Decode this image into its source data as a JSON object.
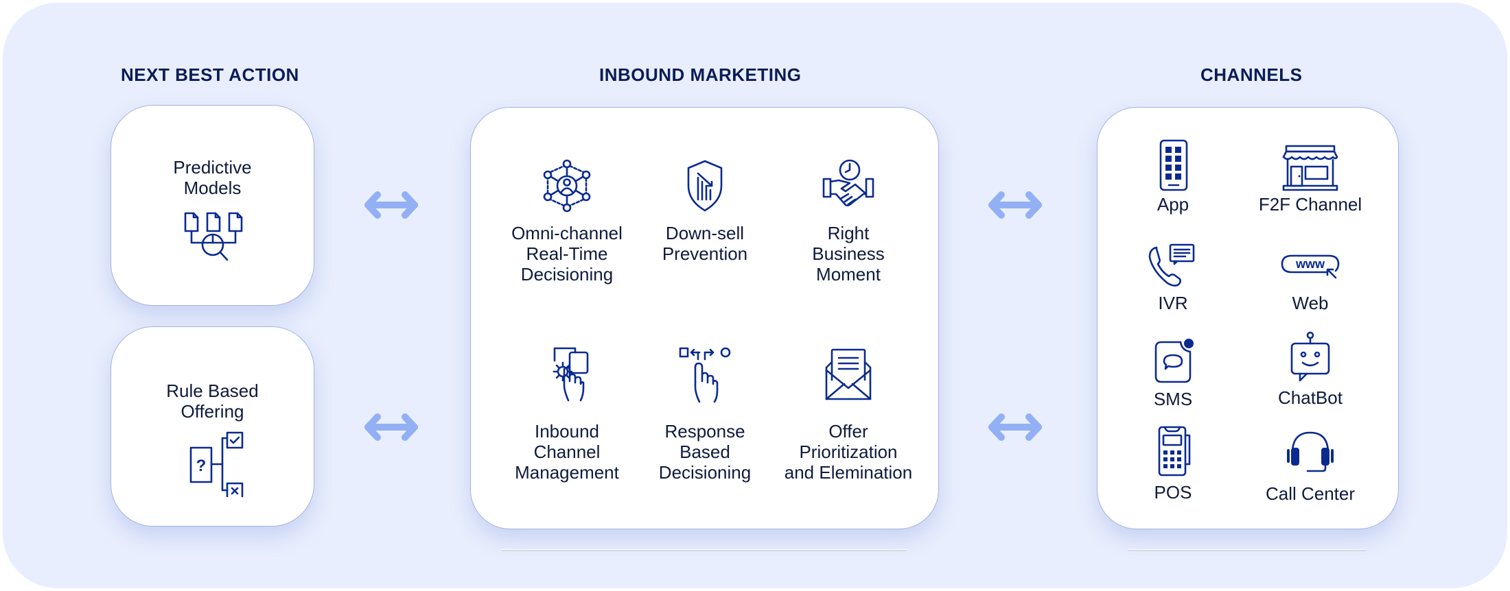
{
  "sections": {
    "next_best_action": {
      "title": "NEXT BEST ACTION",
      "items": [
        {
          "label": "Predictive\nModels",
          "icon": "predictive-models-icon"
        },
        {
          "label": "Rule Based\nOffering",
          "icon": "rule-decision-tree-icon"
        }
      ]
    },
    "inbound_marketing": {
      "title": "INBOUND MARKETING",
      "items": [
        {
          "label": "Omni-channel\nReal-Time\nDecisioning",
          "icon": "network-person-icon"
        },
        {
          "label": "Down-sell\nPrevention",
          "icon": "shield-chart-down-icon"
        },
        {
          "label": "Right\nBusiness\nMoment",
          "icon": "handshake-clock-icon"
        },
        {
          "label": "Inbound\nChannel\nManagement",
          "icon": "gear-touch-icon"
        },
        {
          "label": "Response\nBased\nDecisioning",
          "icon": "tap-choice-icon"
        },
        {
          "label": "Offer\nPrioritization\nand Elemination",
          "icon": "envelope-letter-icon"
        }
      ]
    },
    "channels": {
      "title": "CHANNELS",
      "items": [
        {
          "label": "App",
          "icon": "mobile-app-icon"
        },
        {
          "label": "F2F Channel",
          "icon": "storefront-icon"
        },
        {
          "label": "IVR",
          "icon": "phone-message-icon"
        },
        {
          "label": "Web",
          "icon": "www-cursor-icon"
        },
        {
          "label": "SMS",
          "icon": "sms-bubble-icon"
        },
        {
          "label": "ChatBot",
          "icon": "chatbot-icon"
        },
        {
          "label": "POS",
          "icon": "pos-terminal-icon"
        },
        {
          "label": "Call Center",
          "icon": "headset-icon"
        }
      ]
    }
  },
  "connectors": [
    "bidirectional-arrow",
    "bidirectional-arrow",
    "bidirectional-arrow",
    "bidirectional-arrow"
  ],
  "colors": {
    "background": "#e8eefd",
    "title": "#0b1c57",
    "icon": "#0a2a8f",
    "arrow": "#93b0f5",
    "card": "#ffffff"
  }
}
